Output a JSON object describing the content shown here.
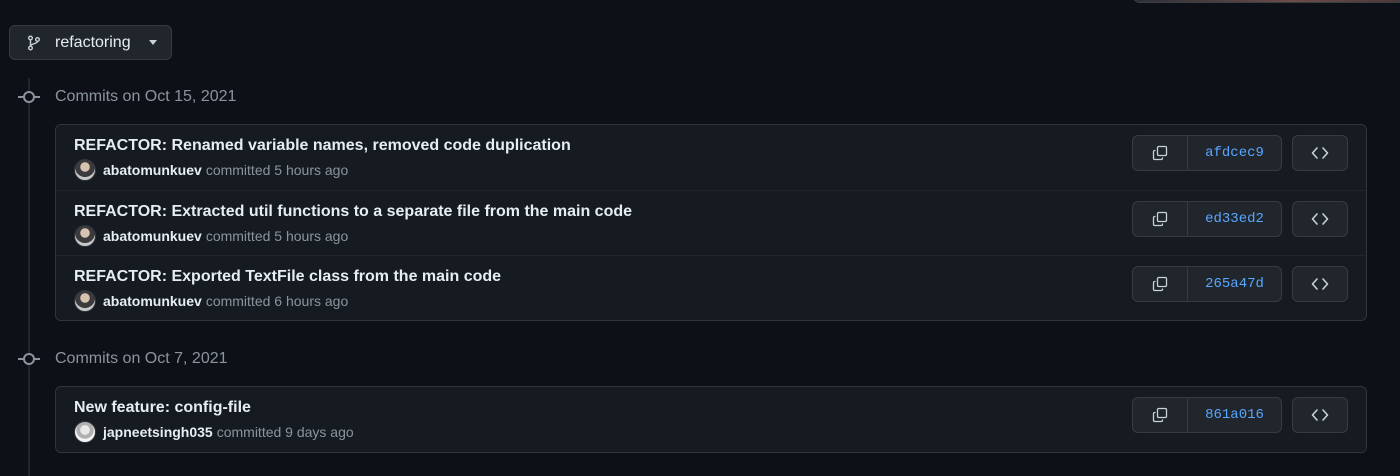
{
  "branch": {
    "label": "refactoring"
  },
  "groups": [
    {
      "title": "Commits on Oct 15, 2021",
      "commits": [
        {
          "message": "REFACTOR: Renamed variable names, removed code duplication",
          "author": "abatomunkuev",
          "action": "committed",
          "time": "5 hours ago",
          "sha": "afdcec9"
        },
        {
          "message": "REFACTOR: Extracted util functions to a separate file from the main code",
          "author": "abatomunkuev",
          "action": "committed",
          "time": "5 hours ago",
          "sha": "ed33ed2"
        },
        {
          "message": "REFACTOR: Exported TextFile class from the main code",
          "author": "abatomunkuev",
          "action": "committed",
          "time": "6 hours ago",
          "sha": "265a47d"
        }
      ]
    },
    {
      "title": "Commits on Oct 7, 2021",
      "commits": [
        {
          "message": "New feature: config-file",
          "author": "japneetsingh035",
          "action": "committed",
          "time": "9 days ago",
          "sha": "861a016"
        }
      ]
    }
  ],
  "icons": {
    "branch": "git-branch-icon",
    "caret": "caret-down-icon",
    "commit_node": "git-commit-icon",
    "copy": "copy-icon",
    "browse": "code-icon"
  },
  "colors": {
    "background": "#0d1117",
    "link": "#58a6ff",
    "muted": "#8b949e",
    "text": "#e6edf3"
  }
}
